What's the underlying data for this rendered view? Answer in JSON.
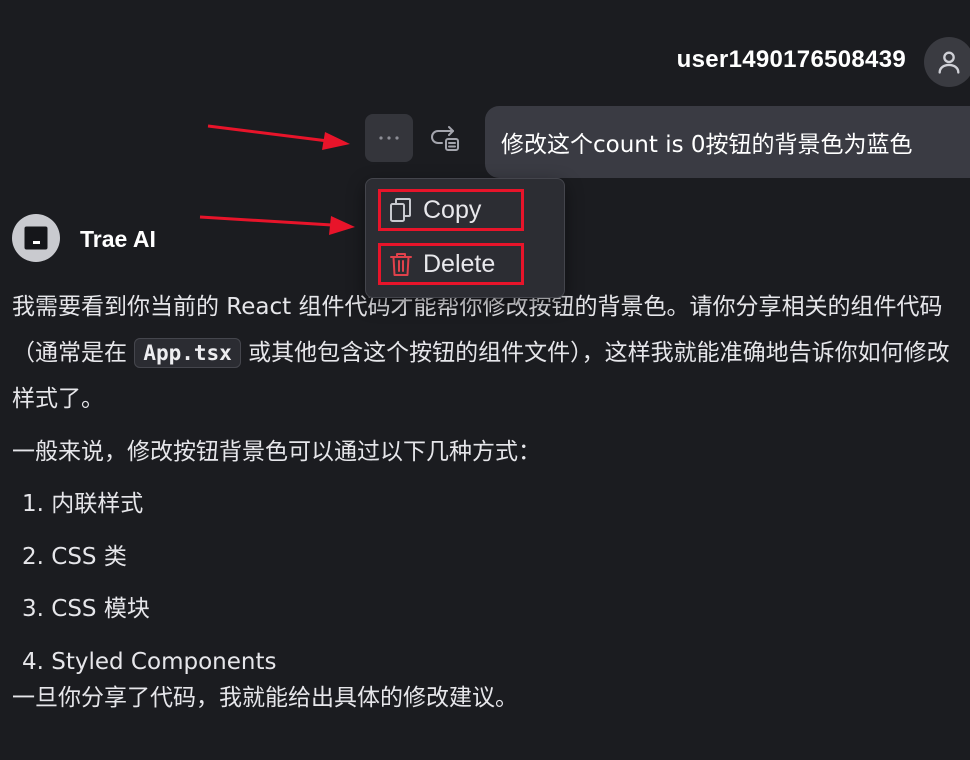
{
  "user": {
    "name": "user1490176508439",
    "avatar_icon": "person-icon"
  },
  "message": {
    "text": "修改这个count is 0按钮的背景色为蓝色"
  },
  "actions": {
    "more_label": "···",
    "more_icon": "ellipsis-icon",
    "resend_icon": "redo-icon"
  },
  "menu": {
    "copy": {
      "label": "Copy",
      "icon": "copy-icon"
    },
    "delete": {
      "label": "Delete",
      "icon": "trash-icon",
      "color": "#e0414b"
    }
  },
  "assistant": {
    "name": "Trae AI",
    "avatar_icon": "terminal-icon"
  },
  "response": {
    "p1_before": "我需要看到你当前的 React 组件代码才能帮你修改按钮的背景色。请你分享相关的组件代码（通常是在 ",
    "p1_code": "App.tsx",
    "p1_after": " 或其他包含这个按钮的组件文件），这样我就能准确地告诉你如何修改样式了。",
    "p2": "一般来说，修改按钮背景色可以通过以下几种方式：",
    "list": [
      "1. 内联样式",
      "2. CSS 类",
      "3. CSS 模块",
      "4. Styled Components"
    ],
    "p3": "一旦你分享了代码，我就能给出具体的修改建议。"
  },
  "colors": {
    "background": "#1b1c20",
    "bubble": "#3a3b43",
    "annotation": "#e8142a"
  }
}
